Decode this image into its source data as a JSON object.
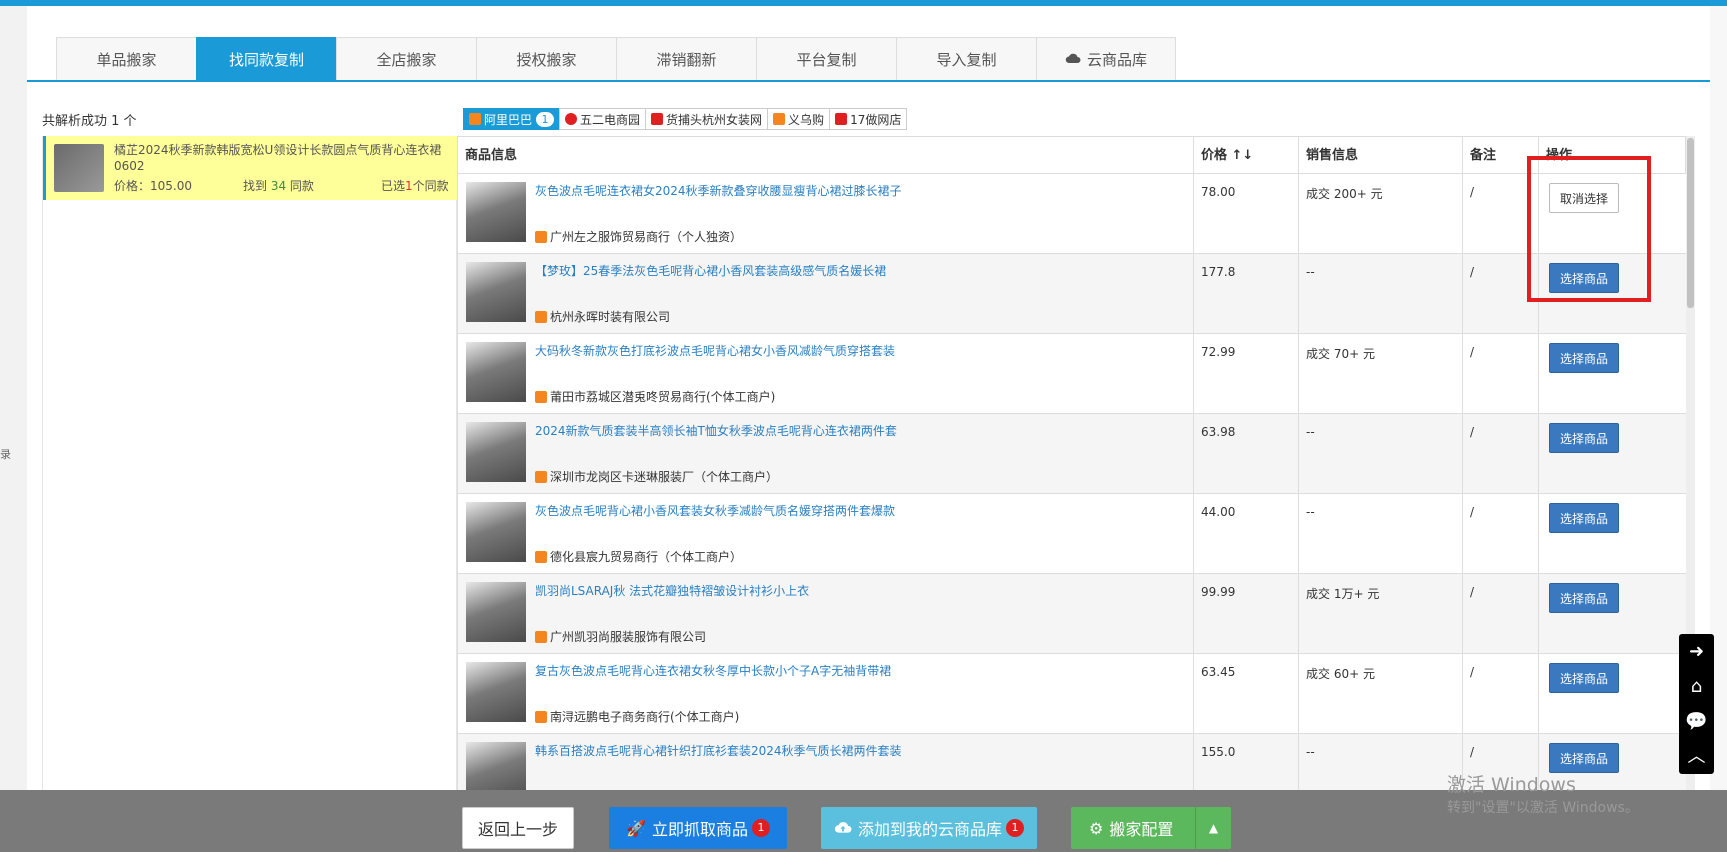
{
  "tabs": [
    {
      "label": "单品搬家"
    },
    {
      "label": "找同款复制",
      "active": true
    },
    {
      "label": "全店搬家"
    },
    {
      "label": "授权搬家"
    },
    {
      "label": "滞销翻新"
    },
    {
      "label": "平台复制"
    },
    {
      "label": "导入复制"
    },
    {
      "label": "云商品库",
      "icon": "cloud-icon"
    }
  ],
  "left_edge_text": "录",
  "summary": "共解析成功 1 个",
  "source_item": {
    "title": "橘芷2024秋季新款韩版宽松U领设计长款圆点气质背心连衣裙0602",
    "price_label": "价格：105.00",
    "found_prefix": "找到 ",
    "found_count": "34",
    "found_suffix": " 同款",
    "picked_prefix": "已选",
    "picked_count": "1",
    "picked_suffix": "个同款"
  },
  "sources": [
    {
      "label": "阿里巴巴",
      "badge": "1",
      "active": true,
      "color": "#f5851f"
    },
    {
      "label": "五二电商园",
      "color": "#e02020"
    },
    {
      "label": "货捕头杭州女装网",
      "color": "#e02020"
    },
    {
      "label": "义乌购",
      "color": "#f5851f"
    },
    {
      "label": "17做网店",
      "color": "#e02020"
    }
  ],
  "table": {
    "headers": [
      "商品信息",
      "价格 ↑↓",
      "销售信息",
      "备注",
      "操作"
    ],
    "rows": [
      {
        "title": "灰色波点毛呢连衣裙女2024秋季新款叠穿收腰显瘦背心裙过膝长裙子",
        "shop": "广州左之服饰贸易商行（个人独资）",
        "price": "78.00",
        "sales": "成交 200+ 元",
        "note": "/",
        "action": "取消选择",
        "selected": true
      },
      {
        "title": "【梦玫】25春季法灰色毛呢背心裙小香风套装高级感气质名媛长裙",
        "shop": "杭州永晖时装有限公司",
        "price": "177.8",
        "sales": "--",
        "note": "/",
        "action": "选择商品"
      },
      {
        "title": "大码秋冬新款灰色打底衫波点毛呢背心裙女小香风减龄气质穿搭套装",
        "shop": "莆田市荔城区潜兎咚贸易商行(个体工商户)",
        "price": "72.99",
        "sales": "成交 70+ 元",
        "note": "/",
        "action": "选择商品"
      },
      {
        "title": "2024新款气质套装半高领长袖T恤女秋季波点毛呢背心连衣裙两件套",
        "shop": "深圳市龙岗区卡迷琳服装厂（个体工商户）",
        "price": "63.98",
        "sales": "--",
        "note": "/",
        "action": "选择商品"
      },
      {
        "title": "灰色波点毛呢背心裙小香风套装女秋季减龄气质名媛穿搭两件套爆款",
        "shop": "德化县宸九贸易商行（个体工商户）",
        "price": "44.00",
        "sales": "--",
        "note": "/",
        "action": "选择商品"
      },
      {
        "title": "凯羽尚LSARAJ秋 法式花瓣独特褶皱设计衬衫小上衣",
        "shop": "广州凯羽尚服装服饰有限公司",
        "price": "99.99",
        "sales": "成交 1万+ 元",
        "note": "/",
        "action": "选择商品"
      },
      {
        "title": "复古灰色波点毛呢背心连衣裙女秋冬厚中长款小个子A字无袖背带裙",
        "shop": "南浔远鹏电子商务商行(个体工商户)",
        "price": "63.45",
        "sales": "成交 60+ 元",
        "note": "/",
        "action": "选择商品"
      },
      {
        "title": "韩系百搭波点毛呢背心裙针织打底衫套装2024秋季气质长裙两件套装",
        "shop": "",
        "price": "155.0",
        "sales": "--",
        "note": "/",
        "action": "选择商品"
      }
    ]
  },
  "watermark": {
    "line1": "激活 Windows",
    "line2": "转到\"设置\"以激活 Windows。"
  },
  "bottom": {
    "back": "返回上一步",
    "grab": "立即抓取商品",
    "grab_badge": "1",
    "cloud": "添加到我的云商品库",
    "cloud_badge": "1",
    "config": "搬家配置"
  },
  "colors": {
    "accent": "#1a9bd7",
    "link": "#2a7fc2",
    "button": "#3a78bf",
    "highlight": "#ffff99",
    "annotation": "#e02020"
  }
}
